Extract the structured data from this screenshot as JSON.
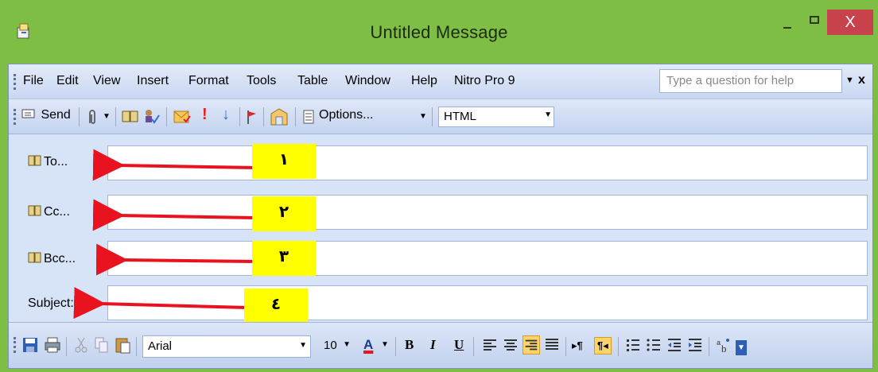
{
  "window": {
    "title": "Untitled Message",
    "close_glyph": "X"
  },
  "menu": {
    "items": [
      "File",
      "Edit",
      "View",
      "Insert",
      "Format",
      "Tools",
      "Table",
      "Window",
      "Help",
      "Nitro Pro 9"
    ],
    "help_placeholder": "Type a question for help",
    "close_glyph": "x"
  },
  "toolbar": {
    "send_label": "Send",
    "options_label": "Options...",
    "format_value": "HTML"
  },
  "fields": {
    "to_label": "To...",
    "cc_label": "Cc...",
    "bcc_label": "Bcc...",
    "subject_label": "Subject:"
  },
  "markers": [
    "١",
    "٢",
    "٣",
    "٤"
  ],
  "format_bar": {
    "font_name": "Arial",
    "font_size": "10",
    "font_color_letter": "A",
    "bold": "B",
    "italic": "I",
    "underline": "U"
  },
  "colors": {
    "titlebar": "#7fbe45",
    "close_button": "#c7424a",
    "arrow": "#e8131f",
    "marker": "#ffff00",
    "chrome": "#cddaf3"
  }
}
